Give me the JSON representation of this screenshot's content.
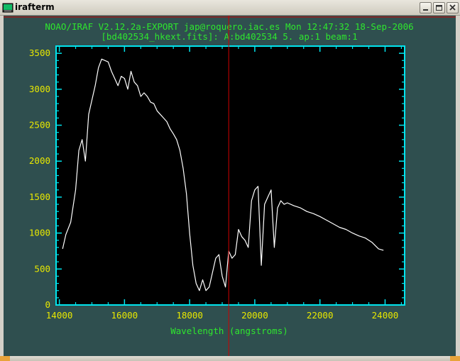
{
  "window": {
    "title": "irafterm",
    "buttons": {
      "minimize": "minimize-icon",
      "maximize": "maximize-icon",
      "close": "close-icon"
    }
  },
  "colors": {
    "terminal_bg": "#2f4f4f",
    "plot_bg": "#000000",
    "frame": "#00e5ee",
    "header_text": "#2ee62e",
    "tick_text": "#e8e800",
    "spectrum": "#ffffff",
    "cursor": "#d00000"
  },
  "plot": {
    "header_line1": "NOAO/IRAF V2.12.2a-EXPORT jap@roquero.iac.es Mon 12:47:32 18-Sep-2006",
    "header_line2": "[bd402534_hkext.fits]: A:bd402534 5. ap:1 beam:1"
  },
  "chart_data": {
    "type": "line",
    "title": "",
    "xlabel": "Wavelength (angstroms)",
    "ylabel": "",
    "xlim": [
      13900,
      24600
    ],
    "ylim": [
      0,
      3600
    ],
    "xticks": [
      14000,
      16000,
      18000,
      20000,
      22000,
      24000
    ],
    "yticks": [
      0,
      500,
      1000,
      1500,
      2000,
      2500,
      3000,
      3500
    ],
    "xtick_labels": [
      "14000",
      "16000",
      "18000",
      "20000",
      "22000",
      "24000"
    ],
    "ytick_labels": [
      "0",
      "500",
      "1000",
      "1500",
      "2000",
      "2500",
      "3000",
      "3500"
    ],
    "cursor_x": 19200,
    "grid": false,
    "series": [
      {
        "x": [
          14100,
          14200,
          14350,
          14500,
          14600,
          14700,
          14800,
          14900,
          15000,
          15100,
          15200,
          15300,
          15400,
          15500,
          15600,
          15700,
          15800,
          15900,
          16000,
          16100,
          16200,
          16300,
          16400,
          16500,
          16600,
          16700,
          16800,
          16900,
          17000,
          17100,
          17200,
          17300,
          17400,
          17500,
          17600,
          17700,
          17800,
          17900,
          18000,
          18100,
          18200,
          18300,
          18400,
          18500,
          18600,
          18700,
          18800,
          18900,
          19000,
          19100,
          19200,
          19300,
          19400,
          19500,
          19600,
          19700,
          19800,
          19900,
          20000,
          20100,
          20200,
          20300,
          20400,
          20500,
          20600,
          20700,
          20800,
          20900,
          21000,
          21200,
          21400,
          21600,
          21800,
          22000,
          22200,
          22400,
          22600,
          22800,
          23000,
          23200,
          23400,
          23600,
          23800,
          23950
        ],
        "values": [
          780,
          980,
          1150,
          1600,
          2150,
          2300,
          2000,
          2650,
          2850,
          3050,
          3300,
          3420,
          3400,
          3380,
          3250,
          3150,
          3050,
          3180,
          3150,
          3000,
          3250,
          3100,
          3050,
          2900,
          2950,
          2900,
          2820,
          2800,
          2700,
          2650,
          2600,
          2550,
          2450,
          2380,
          2300,
          2150,
          1900,
          1550,
          1000,
          550,
          300,
          200,
          350,
          200,
          250,
          450,
          650,
          700,
          400,
          250,
          750,
          650,
          700,
          1050,
          950,
          900,
          800,
          1450,
          1600,
          1650,
          550,
          1400,
          1500,
          1600,
          800,
          1350,
          1450,
          1400,
          1420,
          1380,
          1350,
          1300,
          1270,
          1230,
          1180,
          1130,
          1080,
          1050,
          1000,
          960,
          930,
          870,
          780,
          760
        ]
      }
    ]
  }
}
